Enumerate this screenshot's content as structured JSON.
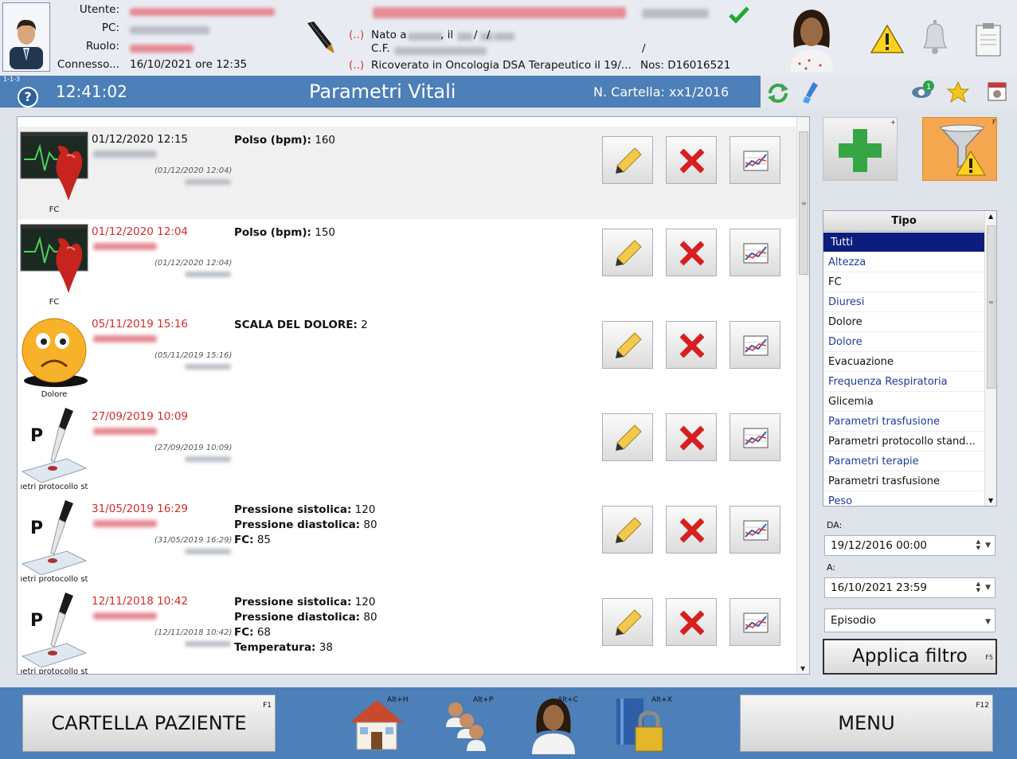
{
  "header": {
    "labels": {
      "utente": "Utente:",
      "pc": "PC:",
      "ruolo": "Ruolo:",
      "connesso": "Connesso..."
    },
    "connesso_value": "16/10/2021 ore 12:35",
    "nato_prefix": "Nato a",
    "nato_il": ", il",
    "date_sep1": "/",
    "date_sep2": "/",
    "cf_label": "C.F.",
    "cf_slash": "/",
    "marker": "(..)",
    "ricoverato": "Ricoverato in Oncologia DSA Terapeutico il 19/...",
    "nos": "Nos: D16016521"
  },
  "titlebar": {
    "version": "1-1-3",
    "help": "?",
    "clock": "12:41:02",
    "title": "Parametri Vitali",
    "cartella": "N. Cartella: xx1/2016"
  },
  "records": [
    {
      "date": "01/12/2020 12:15",
      "date_red": false,
      "sub": "(01/12/2020 12:04)",
      "icon": "heart-monitor",
      "icon_label": "FC",
      "params": [
        {
          "label": "Polso (bpm):",
          "value": "160"
        }
      ]
    },
    {
      "date": "01/12/2020 12:04",
      "date_red": true,
      "sub": "(01/12/2020 12:04)",
      "icon": "heart-monitor",
      "icon_label": "FC",
      "params": [
        {
          "label": "Polso (bpm):",
          "value": "150"
        }
      ]
    },
    {
      "date": "05/11/2019 15:16",
      "date_red": true,
      "sub": "(05/11/2019 15:16)",
      "icon": "sad-face",
      "icon_label": "Dolore",
      "params": [
        {
          "label": "SCALA DEL DOLORE:",
          "value": "2"
        }
      ]
    },
    {
      "date": "27/09/2019 10:09",
      "date_red": true,
      "sub": "(27/09/2019 10:09)",
      "icon": "pipette",
      "icon_label": "ıetri protocollo st",
      "params": []
    },
    {
      "date": "31/05/2019 16:29",
      "date_red": true,
      "sub": "(31/05/2019 16:29)",
      "icon": "pipette",
      "icon_label": "ıetri protocollo st",
      "params": [
        {
          "label": "Pressione sistolica:",
          "value": "120"
        },
        {
          "label": "Pressione diastolica:",
          "value": "80"
        },
        {
          "label": "FC:",
          "value": "85"
        }
      ]
    },
    {
      "date": "12/11/2018 10:42",
      "date_red": true,
      "sub": "(12/11/2018 10:42)",
      "icon": "pipette",
      "icon_label": "ıetri protocollo st",
      "params": [
        {
          "label": "Pressione sistolica:",
          "value": "120"
        },
        {
          "label": "Pressione diastolica:",
          "value": "80"
        },
        {
          "label": "FC:",
          "value": "68"
        },
        {
          "label": "Temperatura:",
          "value": "38"
        }
      ]
    }
  ],
  "right_panel": {
    "add_key": "+",
    "filter_key": "F",
    "tipo_header": "Tipo",
    "tipo_items": [
      {
        "label": "Tutti",
        "style": "sel"
      },
      {
        "label": "Altezza",
        "style": "blue"
      },
      {
        "label": "FC",
        "style": "plain"
      },
      {
        "label": "Diuresi",
        "style": "blue"
      },
      {
        "label": "Dolore",
        "style": "plain"
      },
      {
        "label": "Dolore",
        "style": "blue"
      },
      {
        "label": "Evacuazione",
        "style": "plain"
      },
      {
        "label": "Frequenza Respiratoria",
        "style": "blue"
      },
      {
        "label": "Glicemia",
        "style": "plain"
      },
      {
        "label": "Parametri trasfusione",
        "style": "blue"
      },
      {
        "label": "Parametri  protocollo  stand...",
        "style": "plain"
      },
      {
        "label": "Parametri terapie",
        "style": "blue"
      },
      {
        "label": "Parametri trasfusione",
        "style": "plain"
      },
      {
        "label": "Peso",
        "style": "blue"
      }
    ],
    "da_label": "DA:",
    "da_value": "19/12/2016 00:00",
    "a_label": "A:",
    "a_value": "16/10/2021 23:59",
    "episodio": "Episodio",
    "applica": "Applica filtro",
    "applica_key": "F5"
  },
  "footer": {
    "cartella_btn": "CARTELLA PAZIENTE",
    "cartella_key": "F1",
    "home_key": "Alt+H",
    "patients_key": "Alt+P",
    "user_key": "Alt+C",
    "lock_key": "Alt+X",
    "menu_btn": "MENU",
    "menu_key": "F12"
  },
  "colors": {
    "accent": "#4d7fb8",
    "selected": "#0c1d7d",
    "date_red": "#d42b2b"
  }
}
